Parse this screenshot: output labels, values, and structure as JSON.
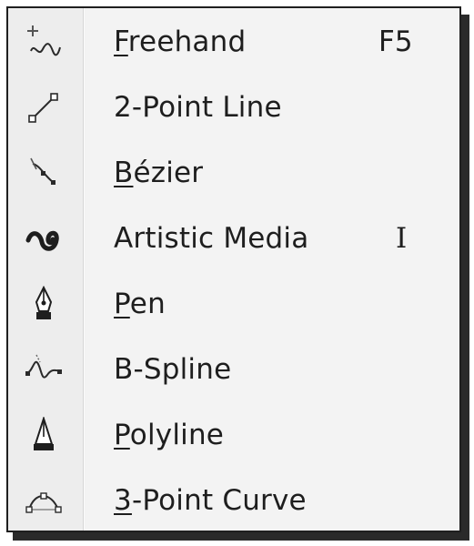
{
  "menu": {
    "items": [
      {
        "label_mnemonic": "F",
        "label_rest": "reehand",
        "shortcut": "F5",
        "icon": "freehand-icon"
      },
      {
        "label_mnemonic": "",
        "label_rest": "2-Point Line",
        "shortcut": "",
        "icon": "two-point-line-icon"
      },
      {
        "label_mnemonic": "B",
        "label_rest": "ézier",
        "shortcut": "",
        "icon": "bezier-icon"
      },
      {
        "label_mnemonic": "",
        "label_rest": "Artistic Media",
        "shortcut": "I",
        "icon": "artistic-media-icon"
      },
      {
        "label_mnemonic": "P",
        "label_rest": "en",
        "shortcut": "",
        "icon": "pen-icon"
      },
      {
        "label_mnemonic": "",
        "label_rest": "B-Spline",
        "shortcut": "",
        "icon": "b-spline-icon"
      },
      {
        "label_mnemonic": "P",
        "label_rest": "olyline",
        "shortcut": "",
        "icon": "polyline-icon"
      },
      {
        "label_mnemonic": "3",
        "label_rest": "-Point Curve",
        "shortcut": "",
        "icon": "three-point-curve-icon"
      }
    ]
  }
}
